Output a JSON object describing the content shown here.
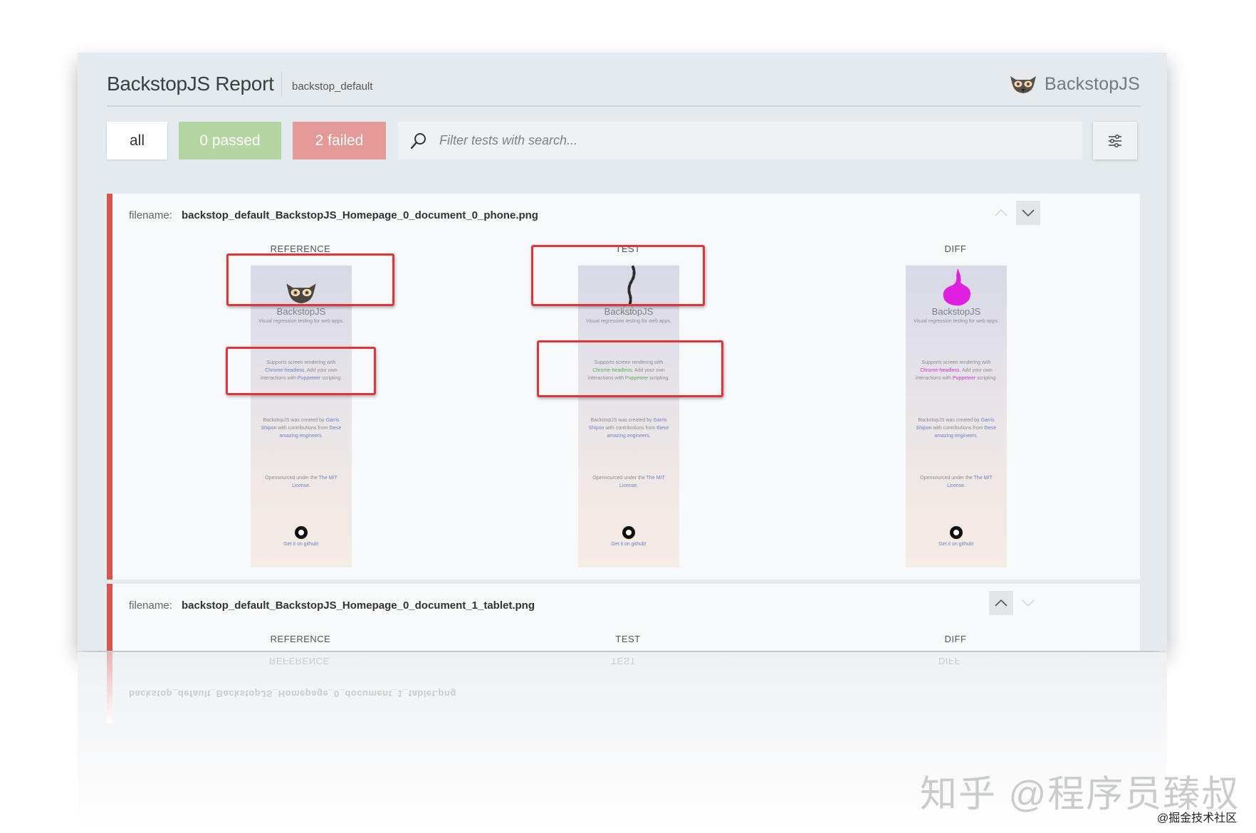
{
  "header": {
    "title": "BackstopJS Report",
    "subtitle": "backstop_default",
    "brand": "BackstopJS"
  },
  "filters": {
    "all": "all",
    "passed": "0 passed",
    "failed": "2 failed"
  },
  "search": {
    "placeholder": "Filter tests with search..."
  },
  "tests": [
    {
      "filename_label": "filename:",
      "filename": "backstop_default_BackstopJS_Homepage_0_document_0_phone.png",
      "status": "failed",
      "columns": [
        "REFERENCE",
        "TEST",
        "DIFF"
      ]
    },
    {
      "filename_label": "filename:",
      "filename": "backstop_default_BackstopJS_Homepage_0_document_1_tablet.png",
      "status": "failed",
      "columns": [
        "REFERENCE",
        "TEST",
        "DIFF"
      ]
    }
  ],
  "screenshot": {
    "title": "BackstopJS",
    "tagline": "Visual regression testing for web apps.",
    "p1_a": "Supports screen rendering with ",
    "p1_link1": "Chrome-headless",
    "p1_b": ". Add your own interactions with ",
    "p1_link2": "Puppeteer",
    "p1_c": " scripting.",
    "p2_a": "BackstopJS was created by ",
    "p2_link1": "Garris Shipon",
    "p2_b": " with contributions from ",
    "p2_link2": "these amazing engineers",
    "p2_c": ".",
    "p3_a": "Opensourced under the ",
    "p3_link": "The MIT License",
    "p3_b": ".",
    "github": "Get it on github!"
  },
  "colors": {
    "failed": "#d9534f",
    "passed": "#b5d6a2",
    "diff": "#e020e0",
    "annotation": "#e0343b"
  },
  "watermark": {
    "main": "知乎 @程序员臻叔",
    "sub": "@掘金技术社区"
  }
}
